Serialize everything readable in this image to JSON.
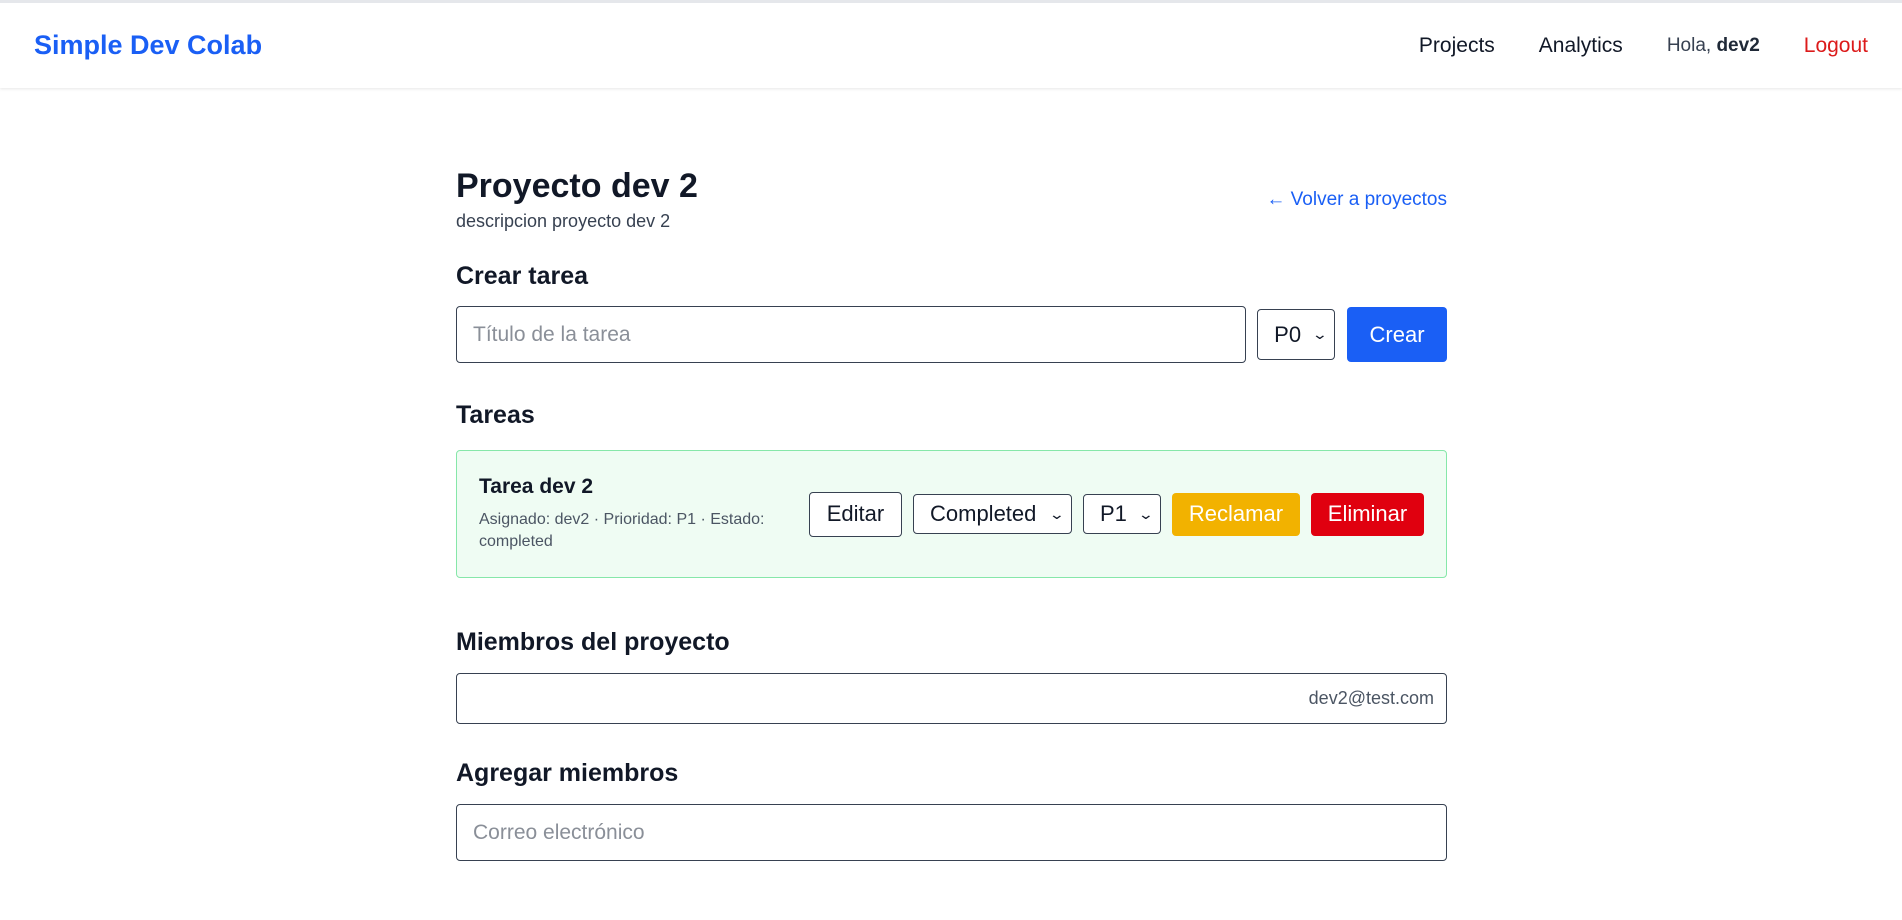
{
  "navbar": {
    "brand": "Simple Dev Colab",
    "links": {
      "projects": "Projects",
      "analytics": "Analytics"
    },
    "greeting_prefix": "Hola,",
    "username": "dev2",
    "logout": "Logout"
  },
  "project": {
    "title": "Proyecto dev 2",
    "description": "descripcion proyecto dev 2",
    "back_link": "← Volver a proyectos"
  },
  "create_task": {
    "heading": "Crear tarea",
    "title_placeholder": "Título de la tarea",
    "priority_selected": "P0",
    "create_label": "Crear"
  },
  "tasks": {
    "heading": "Tareas",
    "items": [
      {
        "title": "Tarea dev 2",
        "meta": "Asignado: dev2 · Prioridad: P1 · Estado: completed",
        "edit_label": "Editar",
        "status_selected": "Completed",
        "priority_selected": "P1",
        "claim_label": "Reclamar",
        "delete_label": "Eliminar"
      }
    ]
  },
  "members": {
    "heading": "Miembros del proyecto",
    "list": [
      "dev2@test.com"
    ]
  },
  "add_members": {
    "heading": "Agregar miembros",
    "email_placeholder": "Correo electrónico"
  },
  "colors": {
    "primary": "#1a5ff5",
    "danger": "#e0000f",
    "warning": "#f2b200",
    "task_bg": "#effcf3",
    "task_border": "#86e7a9"
  },
  "icons": {
    "select_chevron": "chevron-down-icon",
    "back_arrow": "arrow-left-icon"
  }
}
